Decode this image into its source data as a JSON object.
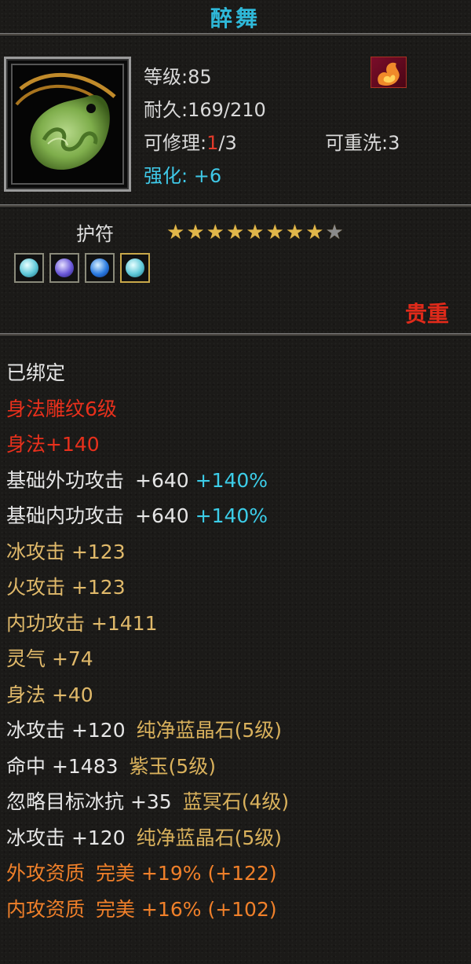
{
  "item": {
    "name": "醉舞",
    "level_text": "等级:85",
    "durability_text": "耐久:169/210",
    "repair_label": "可修理:",
    "repair_current": "1",
    "repair_rest": "/3",
    "rewash_text": "可重洗:3",
    "enhance_label": "强化:",
    "enhance_value": "+6",
    "type": "护符",
    "stars_total": 9,
    "stars_filled": 8,
    "rarity": "贵重",
    "gem_icons": [
      "aqua-gem-icon",
      "purple-gem-icon",
      "blue-gem-icon",
      "aqua-gem-icon"
    ],
    "colors": {
      "title": "#2fb8d8",
      "rarity": "#e02a1a",
      "gold": "#e0b96a",
      "orange": "#f0802a",
      "cyan": "#3ccde8",
      "red": "#e8301c"
    }
  },
  "attributes": {
    "bound": "已绑定",
    "engrave": "身法雕纹6级",
    "engrave_bonus": "身法+140",
    "ext_atk": {
      "label": "基础外功攻击",
      "value": "+640",
      "pct": "+140%"
    },
    "int_atk": {
      "label": "基础内功攻击",
      "value": "+640",
      "pct": "+140%"
    },
    "ice_atk": "冰攻击 +123",
    "fire_atk": "火攻击 +123",
    "inner_atk": "内功攻击 +1411",
    "spirit": "灵气 +74",
    "agility": "身法 +40",
    "gem1": {
      "stat": "冰攻击 +120",
      "gem": "纯净蓝晶石(5级)"
    },
    "gem2": {
      "stat": "命中 +1483",
      "gem": "紫玉(5级)"
    },
    "gem3": {
      "stat": "忽略目标冰抗 +35",
      "gem": "蓝冥石(4级)"
    },
    "gem4": {
      "stat": "冰攻击 +120",
      "gem": "纯净蓝晶石(5级)"
    },
    "ext_quality": {
      "label": "外攻资质",
      "grade": "完美",
      "value": "+19%",
      "bonus": "(+122)"
    },
    "int_quality": {
      "label": "内攻资质",
      "grade": "完美",
      "value": "+16%",
      "bonus": "(+102)"
    }
  }
}
